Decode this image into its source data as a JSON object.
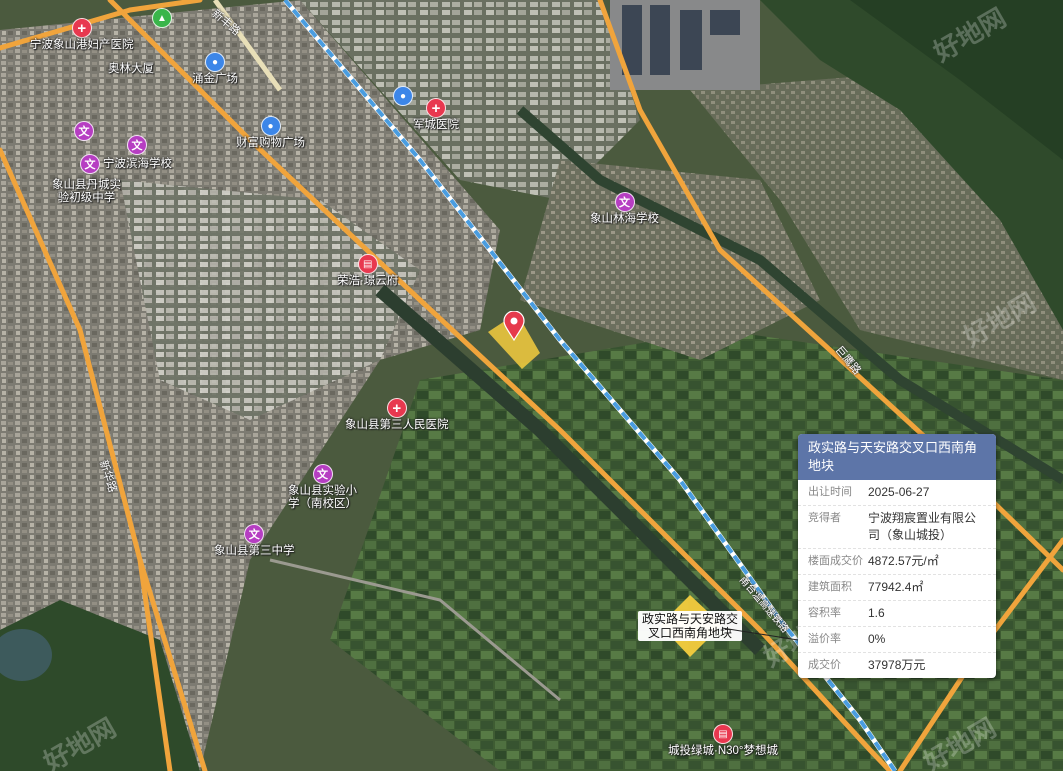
{
  "map": {
    "pois": [
      {
        "id": "xiangshan-gangfu-hospital",
        "type": "hospital",
        "icon": "hospital-cross-icon",
        "label": "宁波象山港妇产医院"
      },
      {
        "id": "aoyuan-mansion",
        "type": "label",
        "label": "奥林大厦"
      },
      {
        "id": "yongjin-plaza",
        "type": "shop",
        "icon": "shopping-bag-icon",
        "label": "涌金广场"
      },
      {
        "id": "caifu-shopping",
        "type": "shop",
        "icon": "shopping-bag-icon",
        "label": "财富购物广场"
      },
      {
        "id": "junhai-hospital",
        "type": "hospital",
        "icon": "hospital-cross-icon",
        "label": "军城医院"
      },
      {
        "id": "school-a",
        "type": "school",
        "icon": "school-icon",
        "label": ""
      },
      {
        "id": "school-b",
        "type": "school",
        "icon": "school-icon",
        "label": ""
      },
      {
        "id": "binhai-school",
        "type": "school",
        "icon": "school-icon",
        "label": "宁波滨海学校"
      },
      {
        "id": "jiancheng-middle",
        "type": "label",
        "label": "象山县丹城实\n验初级中学"
      },
      {
        "id": "linhai-school",
        "type": "school",
        "icon": "school-icon",
        "label": "象山林海学校"
      },
      {
        "id": "ronghao-yunfu",
        "type": "residence",
        "icon": "building-icon",
        "label": "荣浩·璟云府"
      },
      {
        "id": "third-hospital",
        "type": "hospital",
        "icon": "hospital-cross-icon",
        "label": "象山县第三人民医院"
      },
      {
        "id": "shiyan-primary",
        "type": "school",
        "icon": "school-icon",
        "label": "象山县实验小\n学（南校区）"
      },
      {
        "id": "third-middle",
        "type": "school",
        "icon": "school-icon",
        "label": "象山县第三中学"
      },
      {
        "id": "mengxiang-city",
        "type": "residence",
        "icon": "building-icon",
        "label": "城投绿城·N30°梦想城"
      },
      {
        "id": "park-top",
        "type": "park",
        "icon": "mountain-icon",
        "label": ""
      }
    ],
    "roads": [
      {
        "id": "road-xinfeng",
        "label": "新丰路"
      },
      {
        "id": "road-xinhua",
        "label": "新华路"
      },
      {
        "id": "road-baoluo",
        "label": "巨鹰路"
      },
      {
        "id": "rail-label",
        "label": "甬台温高速铁路"
      }
    ],
    "plot": {
      "label": "政实路与天安路交\n叉口西南角地块"
    },
    "watermarks": [
      "好地网",
      "好地网",
      "好地网",
      "好地网",
      "好地网"
    ]
  },
  "info_card": {
    "title": "政实路与天安路交叉口西南角地块",
    "rows": [
      {
        "key": "出让时间",
        "value": "2025-06-27"
      },
      {
        "key": "竞得者",
        "value": "宁波翔宸置业有限公司（象山城投）"
      },
      {
        "key": "楼面成交价",
        "value": "4872.57元/㎡"
      },
      {
        "key": "建筑面积",
        "value": "77942.4㎡"
      },
      {
        "key": "容积率",
        "value": "1.6"
      },
      {
        "key": "溢价率",
        "value": "0%"
      },
      {
        "key": "成交价",
        "value": "37978万元"
      }
    ]
  },
  "colors": {
    "road": "#f0a43c",
    "rail": "#4a9de0",
    "plot_fill": "#f4cc3e",
    "pin": "#e63a4c",
    "card_header": "#5d75a8"
  }
}
